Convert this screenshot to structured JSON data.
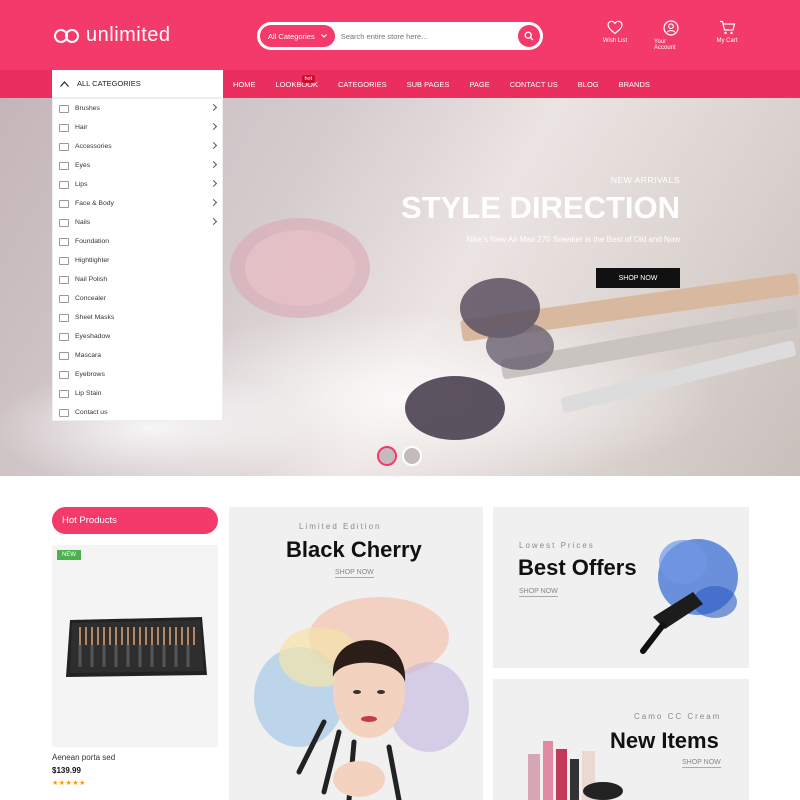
{
  "header": {
    "logo_text": "unlimited",
    "search": {
      "category": "All Categories",
      "placeholder": "Search entire store here..."
    },
    "actions": [
      {
        "label": "Wish List",
        "icon": "heart-icon"
      },
      {
        "label": "Your Account",
        "icon": "user-icon"
      },
      {
        "label": "My Cart",
        "icon": "cart-icon"
      }
    ]
  },
  "nav": {
    "all_categories": "ALL CATEGORIES",
    "hot_badge": "hot",
    "links": [
      "HOME",
      "LOOKBOOK",
      "CATEGORIES",
      "SUB PAGES",
      "PAGE",
      "CONTACT US",
      "BLOG",
      "BRANDS"
    ]
  },
  "categories": [
    {
      "label": "Brushes",
      "has_sub": true
    },
    {
      "label": "Hair",
      "has_sub": true
    },
    {
      "label": "Accessories",
      "has_sub": true
    },
    {
      "label": "Eyes",
      "has_sub": true
    },
    {
      "label": "Lips",
      "has_sub": true
    },
    {
      "label": "Face & Body",
      "has_sub": true
    },
    {
      "label": "Nails",
      "has_sub": true
    },
    {
      "label": "Foundation",
      "has_sub": false
    },
    {
      "label": "Hightlighter",
      "has_sub": false
    },
    {
      "label": "Nail Polish",
      "has_sub": false
    },
    {
      "label": "Concealer",
      "has_sub": false
    },
    {
      "label": "Sheet Masks",
      "has_sub": false
    },
    {
      "label": "Eyeshadow",
      "has_sub": false
    },
    {
      "label": "Mascara",
      "has_sub": false
    },
    {
      "label": "Eyebrows",
      "has_sub": false
    },
    {
      "label": "Lip Stain",
      "has_sub": false
    },
    {
      "label": "Contact us",
      "has_sub": false
    }
  ],
  "hero": {
    "subtitle": "NEW ARRIVALS",
    "title": "STYLE DIRECTION",
    "description": "Nike's New Air Max 270 Sneaker Is the Best of Old and Now",
    "button": "SHOP NOW"
  },
  "hot_products": {
    "title": "Hot Products",
    "product": {
      "badge": "NEW",
      "name": "Aenean porta sed",
      "price": "$139.99",
      "stars": "★★★★★"
    }
  },
  "banners": [
    {
      "subtitle": "Limited Edition",
      "title": "Black Cherry",
      "link": "SHOP NOW"
    },
    {
      "subtitle": "Lowest Prices",
      "title": "Best Offers",
      "link": "SHOP NOW"
    },
    {
      "subtitle": "Camo CC Cream",
      "title": "New Items",
      "link": "SHOP NOW"
    }
  ],
  "colors": {
    "brand": "#f33a6a",
    "nav": "#ea2f5f",
    "new_badge": "#4caf50",
    "stars": "#ff9800"
  }
}
